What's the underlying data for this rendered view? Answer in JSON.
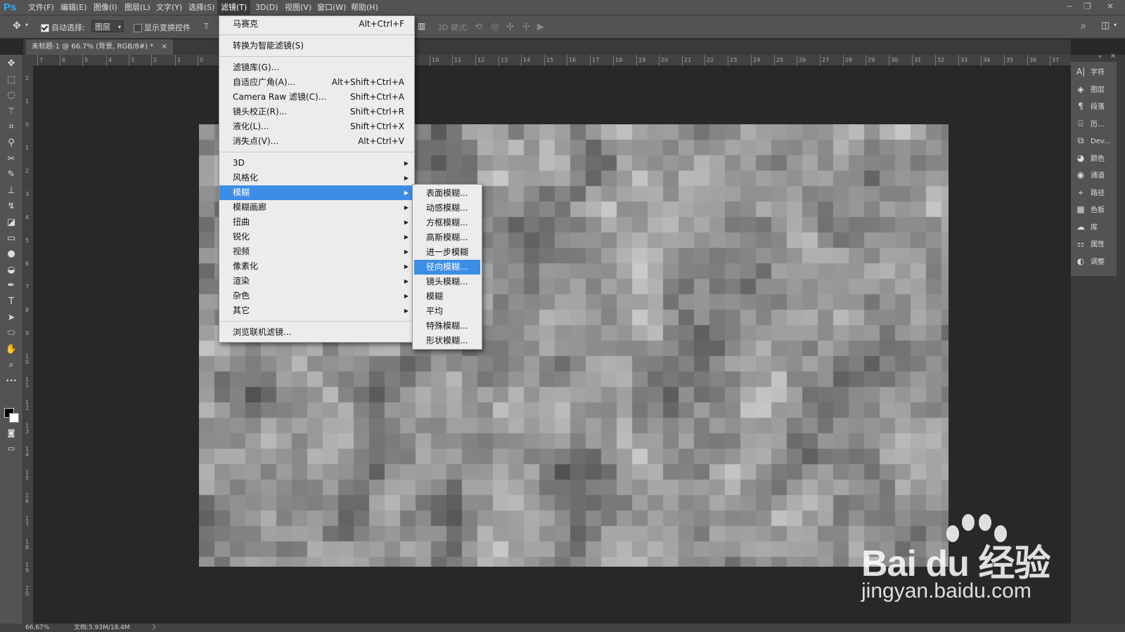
{
  "app": {
    "logo": "Ps"
  },
  "menubar": {
    "items": [
      "文件(F)",
      "编辑(E)",
      "图像(I)",
      "图层(L)",
      "文字(Y)",
      "选择(S)",
      "滤镜(T)",
      "3D(D)",
      "视图(V)",
      "窗口(W)",
      "帮助(H)"
    ],
    "active_index": 6
  },
  "window_controls": {
    "minimize": "─",
    "restore": "❐",
    "close": "✕"
  },
  "options": {
    "auto_select_label": "自动选择:",
    "auto_select_checked": true,
    "layer_dropdown": "图层",
    "show_transform_label": "显示变换控件",
    "show_transform_checked": false,
    "mode_3d_label": "3D 模式:"
  },
  "document_tab": {
    "title": "未标题-1 @ 66.7% (背景, RGB/8#) *",
    "close": "×"
  },
  "ruler": {
    "top_ticks": [
      "7",
      "6",
      "5",
      "4",
      "3",
      "2",
      "1",
      "0",
      "10",
      "11",
      "12",
      "13",
      "14",
      "15",
      "16",
      "17",
      "18",
      "19",
      "20",
      "21",
      "22",
      "23",
      "24",
      "25",
      "26",
      "27",
      "28",
      "29",
      "30",
      "31",
      "32",
      "33",
      "34",
      "35",
      "36",
      "37"
    ],
    "left_ticks": [
      "2",
      "1",
      "0",
      "1",
      "2",
      "3",
      "4",
      "5",
      "6",
      "7",
      "8",
      "9",
      "1\n0",
      "1\n1",
      "1\n2",
      "1\n3",
      "1\n4",
      "1\n5",
      "1\n6",
      "1\n7",
      "1\n8",
      "1\n9",
      "2\n0"
    ]
  },
  "filter_menu": {
    "items": [
      {
        "label": "马赛克",
        "shortcut": "Alt+Ctrl+F"
      },
      {
        "sep": true
      },
      {
        "label": "转换为智能滤镜(S)"
      },
      {
        "sep": true
      },
      {
        "label": "滤镜库(G)..."
      },
      {
        "label": "自适应广角(A)...",
        "shortcut": "Alt+Shift+Ctrl+A"
      },
      {
        "label": "Camera Raw 滤镜(C)...",
        "shortcut": "Shift+Ctrl+A"
      },
      {
        "label": "镜头校正(R)...",
        "shortcut": "Shift+Ctrl+R"
      },
      {
        "label": "液化(L)...",
        "shortcut": "Shift+Ctrl+X"
      },
      {
        "label": "消失点(V)...",
        "shortcut": "Alt+Ctrl+V"
      },
      {
        "sep": true
      },
      {
        "label": "3D",
        "submenu": true
      },
      {
        "label": "风格化",
        "submenu": true
      },
      {
        "label": "模糊",
        "submenu": true,
        "highlighted": true
      },
      {
        "label": "模糊画廊",
        "submenu": true
      },
      {
        "label": "扭曲",
        "submenu": true
      },
      {
        "label": "锐化",
        "submenu": true
      },
      {
        "label": "视频",
        "submenu": true
      },
      {
        "label": "像素化",
        "submenu": true
      },
      {
        "label": "渲染",
        "submenu": true
      },
      {
        "label": "杂色",
        "submenu": true
      },
      {
        "label": "其它",
        "submenu": true
      },
      {
        "sep": true
      },
      {
        "label": "浏览联机滤镜..."
      }
    ]
  },
  "blur_submenu": {
    "items": [
      "表面模糊...",
      "动感模糊...",
      "方框模糊...",
      "高斯模糊...",
      "进一步模糊",
      "径向模糊...",
      "镜头模糊...",
      "模糊",
      "平均",
      "特殊模糊...",
      "形状模糊..."
    ],
    "highlighted_index": 5
  },
  "right_panel": {
    "items": [
      {
        "icon": "A|",
        "label": "字符",
        "name": "character-icon"
      },
      {
        "icon": "◈",
        "label": "图层",
        "name": "layers-icon"
      },
      {
        "icon": "¶",
        "label": "段落",
        "name": "paragraph-icon"
      },
      {
        "icon": "⌸",
        "label": "历...",
        "name": "history-icon"
      },
      {
        "icon": "⧉",
        "label": "Dev...",
        "name": "device-preview-icon"
      },
      {
        "icon": "◕",
        "label": "颜色",
        "name": "color-icon"
      },
      {
        "icon": "◉",
        "label": "通道",
        "name": "channels-icon"
      },
      {
        "icon": "⌖",
        "label": "路径",
        "name": "paths-icon"
      },
      {
        "icon": "▦",
        "label": "色板",
        "name": "swatches-icon"
      },
      {
        "icon": "☁",
        "label": "库",
        "name": "libraries-icon"
      },
      {
        "icon": "⚏",
        "label": "属性",
        "name": "properties-icon"
      },
      {
        "icon": "◐",
        "label": "调整",
        "name": "adjustments-icon"
      }
    ]
  },
  "tools": [
    {
      "name": "move-tool-icon",
      "icon": "✥"
    },
    {
      "name": "marquee-tool-icon",
      "icon": "⬚"
    },
    {
      "name": "lasso-tool-icon",
      "icon": "◌"
    },
    {
      "name": "magic-wand-tool-icon",
      "icon": "⚚"
    },
    {
      "name": "crop-tool-icon",
      "icon": "⌗"
    },
    {
      "name": "eyedropper-tool-icon",
      "icon": "⚲"
    },
    {
      "name": "healing-brush-tool-icon",
      "icon": "✂"
    },
    {
      "name": "brush-tool-icon",
      "icon": "✎"
    },
    {
      "name": "stamp-tool-icon",
      "icon": "⊥"
    },
    {
      "name": "history-brush-tool-icon",
      "icon": "↯"
    },
    {
      "name": "eraser-tool-icon",
      "icon": "◪"
    },
    {
      "name": "gradient-tool-icon",
      "icon": "▭"
    },
    {
      "name": "blur-tool-icon",
      "icon": "●"
    },
    {
      "name": "dodge-tool-icon",
      "icon": "◒"
    },
    {
      "name": "pen-tool-icon",
      "icon": "✒"
    },
    {
      "name": "type-tool-icon",
      "icon": "T"
    },
    {
      "name": "path-selection-tool-icon",
      "icon": "➤"
    },
    {
      "name": "shape-tool-icon",
      "icon": "⬭"
    },
    {
      "name": "hand-tool-icon",
      "icon": "✋"
    },
    {
      "name": "zoom-tool-icon",
      "icon": "⌕"
    },
    {
      "name": "more-tools-icon",
      "icon": "•••"
    }
  ],
  "status": {
    "zoom": "66.67%",
    "doc": "文档:5.93M/18.4M",
    "arrow": "〉"
  },
  "watermark": {
    "top": "Bai du 经验",
    "bottom": "jingyan.baidu.com"
  },
  "colors": {
    "menu_highlight": "#3c8de6",
    "ui_bg": "#535353",
    "workspace": "#282828"
  }
}
